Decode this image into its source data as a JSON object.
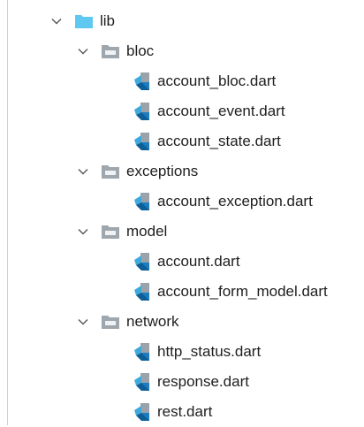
{
  "colors": {
    "lib_folder": "#5ec8f0",
    "package_folder": "#9ea7ad",
    "dart_light": "#3fa9dc",
    "dart_dark": "#0d5f96",
    "dart_page": "#9aa3aa",
    "chevron": "#555555"
  },
  "tree": {
    "root": {
      "label": "lib",
      "icon": "folder-icon",
      "expanded": true,
      "children": [
        {
          "label": "bloc",
          "icon": "package-folder-icon",
          "expanded": true,
          "files": [
            "account_bloc.dart",
            "account_event.dart",
            "account_state.dart"
          ]
        },
        {
          "label": "exceptions",
          "icon": "package-folder-icon",
          "expanded": true,
          "files": [
            "account_exception.dart"
          ]
        },
        {
          "label": "model",
          "icon": "package-folder-icon",
          "expanded": true,
          "files": [
            "account.dart",
            "account_form_model.dart"
          ]
        },
        {
          "label": "network",
          "icon": "package-folder-icon",
          "expanded": true,
          "files": [
            "http_status.dart",
            "response.dart",
            "rest.dart"
          ]
        }
      ]
    }
  }
}
